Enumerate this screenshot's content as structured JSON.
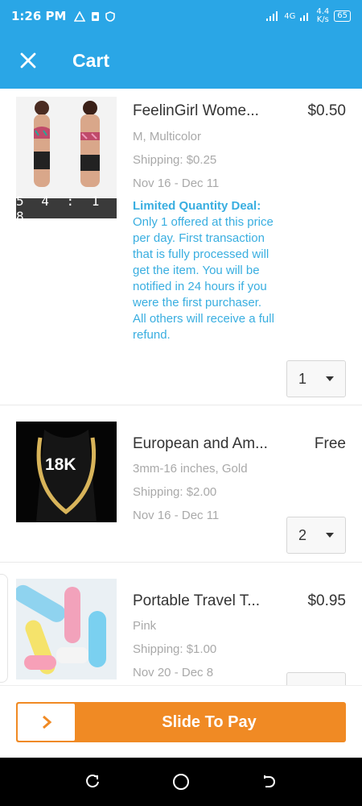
{
  "status_bar": {
    "time": "1:26 PM",
    "network": "4G",
    "speed_top": "4.4",
    "speed_bottom": "K/s",
    "battery": "65"
  },
  "app_bar": {
    "title": "Cart",
    "close_icon": "close-icon"
  },
  "cart_items": [
    {
      "name": "FeelinGirl Wome...",
      "price": "$0.50",
      "variant": "M, Multicolor",
      "shipping": "Shipping: $0.25",
      "delivery": "Nov 16 - Dec 11",
      "timer": "5 4 : 1 8",
      "deal_title": "Limited Quantity Deal:",
      "deal_text": "Only 1 offered at this price per day. First transaction that is fully processed will get the item. You will be notified in 24 hours if you were the first purchaser. All others will receive a full refund.",
      "quantity": "1"
    },
    {
      "name": "European and Am...",
      "price": "Free",
      "variant": "3mm-16 inches, Gold",
      "shipping": "Shipping: $2.00",
      "delivery": "Nov 16 - Dec 11",
      "image_text": "18K",
      "quantity": "2"
    },
    {
      "name": "Portable Travel T...",
      "price": "$0.95",
      "variant": "Pink",
      "shipping": "Shipping: $1.00",
      "delivery": "Nov 20 - Dec 8",
      "quantity": ""
    }
  ],
  "checkout": {
    "slide_label": "Slide To Pay",
    "knob_icon": "chevron-right-icon"
  },
  "colors": {
    "accent": "#2aa6e6",
    "deal": "#39aee0",
    "pay": "#f08a24"
  }
}
